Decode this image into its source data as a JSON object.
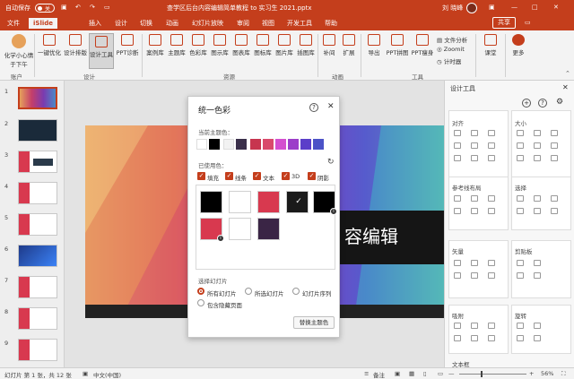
{
  "titlebar": {
    "autosave": "自动保存",
    "toggle_state": "关",
    "doc_title": "查学区后台内容编辑简单教程 to 实习生 2021.pptx",
    "user": "刘 晓峰",
    "window_controls": [
      "—",
      "□",
      "✕"
    ]
  },
  "menubar": {
    "tabs": [
      "文件",
      "iSlide",
      "插入",
      "设计",
      "切换",
      "动画",
      "幻灯片放映",
      "审阅",
      "视图",
      "开发工具",
      "帮助"
    ],
    "share": "共享",
    "comment_icon": "comment-icon"
  },
  "ribbon": {
    "account": {
      "label": "化学小心情",
      "sub": "于下午",
      "group": "账户"
    },
    "design_items": [
      "一键优化",
      "设计排版",
      "设计工具",
      "PPT诊断"
    ],
    "resource_items": [
      "案例库",
      "主题库",
      "色彩库",
      "图示库",
      "图表库",
      "图标库",
      "图片库",
      "插图库"
    ],
    "animation_items": [
      "补间",
      "扩展"
    ],
    "tools_items": [
      "导出",
      "PPT拼图",
      "PPT瘦身"
    ],
    "small_tools": [
      "文件分析",
      "Zoomit",
      "计时器"
    ],
    "course": "课堂",
    "more": "更多",
    "groups": {
      "design": "设计",
      "resource": "资源",
      "animation": "动画",
      "tools": "工具"
    }
  },
  "thumbnails": {
    "numbers": [
      "1",
      "2",
      "3",
      "4",
      "5",
      "6",
      "7",
      "8",
      "9"
    ],
    "current": 1
  },
  "slide": {
    "title": "容编辑"
  },
  "dialog": {
    "title": "统一色彩",
    "current_theme_label": "当前主题色：",
    "theme_colors": [
      "#ffffff",
      "#000000",
      "#f2f2f2",
      "#3a2f4a",
      "#c7354f",
      "#d94a6b",
      "#d44fcf",
      "#9c3dc9",
      "#5b3ec9",
      "#4b52c7"
    ],
    "used_label": "已使用色：",
    "checks": [
      "填充",
      "线条",
      "文本",
      "3D",
      "阴影"
    ],
    "used_colors": [
      {
        "color": "#000000",
        "badge": ""
      },
      {
        "color": "#ffffff",
        "badge": ""
      },
      {
        "color": "#d8394f",
        "badge": ""
      },
      {
        "color": "#1a1a1a",
        "badge": "✓"
      },
      {
        "color": "#000000",
        "badge": "i"
      },
      {
        "color": "#d8394f",
        "badge": "i"
      },
      {
        "color": "#ffffff",
        "badge": ""
      },
      {
        "color": "#3a2545",
        "badge": ""
      }
    ],
    "select_label": "选择幻灯片",
    "radios": [
      "所有幻灯片",
      "所选幻灯片",
      "幻灯片序列",
      "包含隐藏页面"
    ],
    "apply_button": "替换主题色"
  },
  "right_pane": {
    "title": "设计工具",
    "sections": [
      "对齐",
      "大小",
      "参考线布局",
      "选择",
      "矢量",
      "剪贴板",
      "吸附",
      "旋转",
      "文本框"
    ]
  },
  "statusbar": {
    "slide_info": "幻灯片 第 1 张，共 12 张",
    "language": "中文(中国)",
    "notes": "备注",
    "zoom": "56%"
  }
}
